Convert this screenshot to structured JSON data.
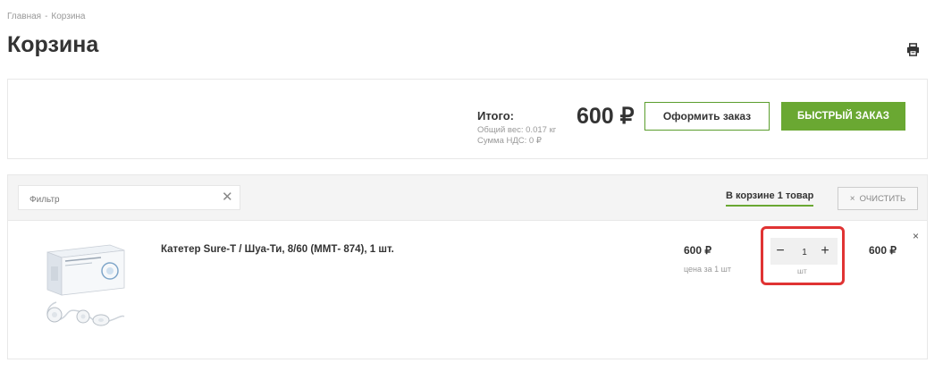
{
  "breadcrumb": {
    "home": "Главная",
    "separator": "-",
    "current": "Корзина"
  },
  "page": {
    "title": "Корзина",
    "print_icon": "printer-icon"
  },
  "summary": {
    "total_label": "Итого:",
    "weight": "Общий вес: 0.017 кг",
    "vat": "Сумма НДС: 0 ₽",
    "total_price": "600 ₽",
    "checkout_label": "Оформить заказ",
    "quick_order_label": "БЫСТРЫЙ ЗАКАЗ"
  },
  "toolbar": {
    "filter_placeholder": "Фильтр",
    "filter_clear_icon": "close-icon",
    "cart_count": "В корзине 1 товар",
    "clear_icon": "×",
    "clear_label": "ОЧИСТИТЬ"
  },
  "items": [
    {
      "title": "Катетер Sure-T / Шуа-Ти, 8/60 (ММТ- 874), 1 шт.",
      "unit_price": "600 ₽",
      "unit_price_label": "цена за 1 шт",
      "quantity": "1",
      "quantity_unit": "шт",
      "minus": "−",
      "plus": "+",
      "line_total": "600 ₽",
      "remove": "×"
    }
  ],
  "colors": {
    "accent": "#6aa832",
    "highlight": "#e03333"
  }
}
